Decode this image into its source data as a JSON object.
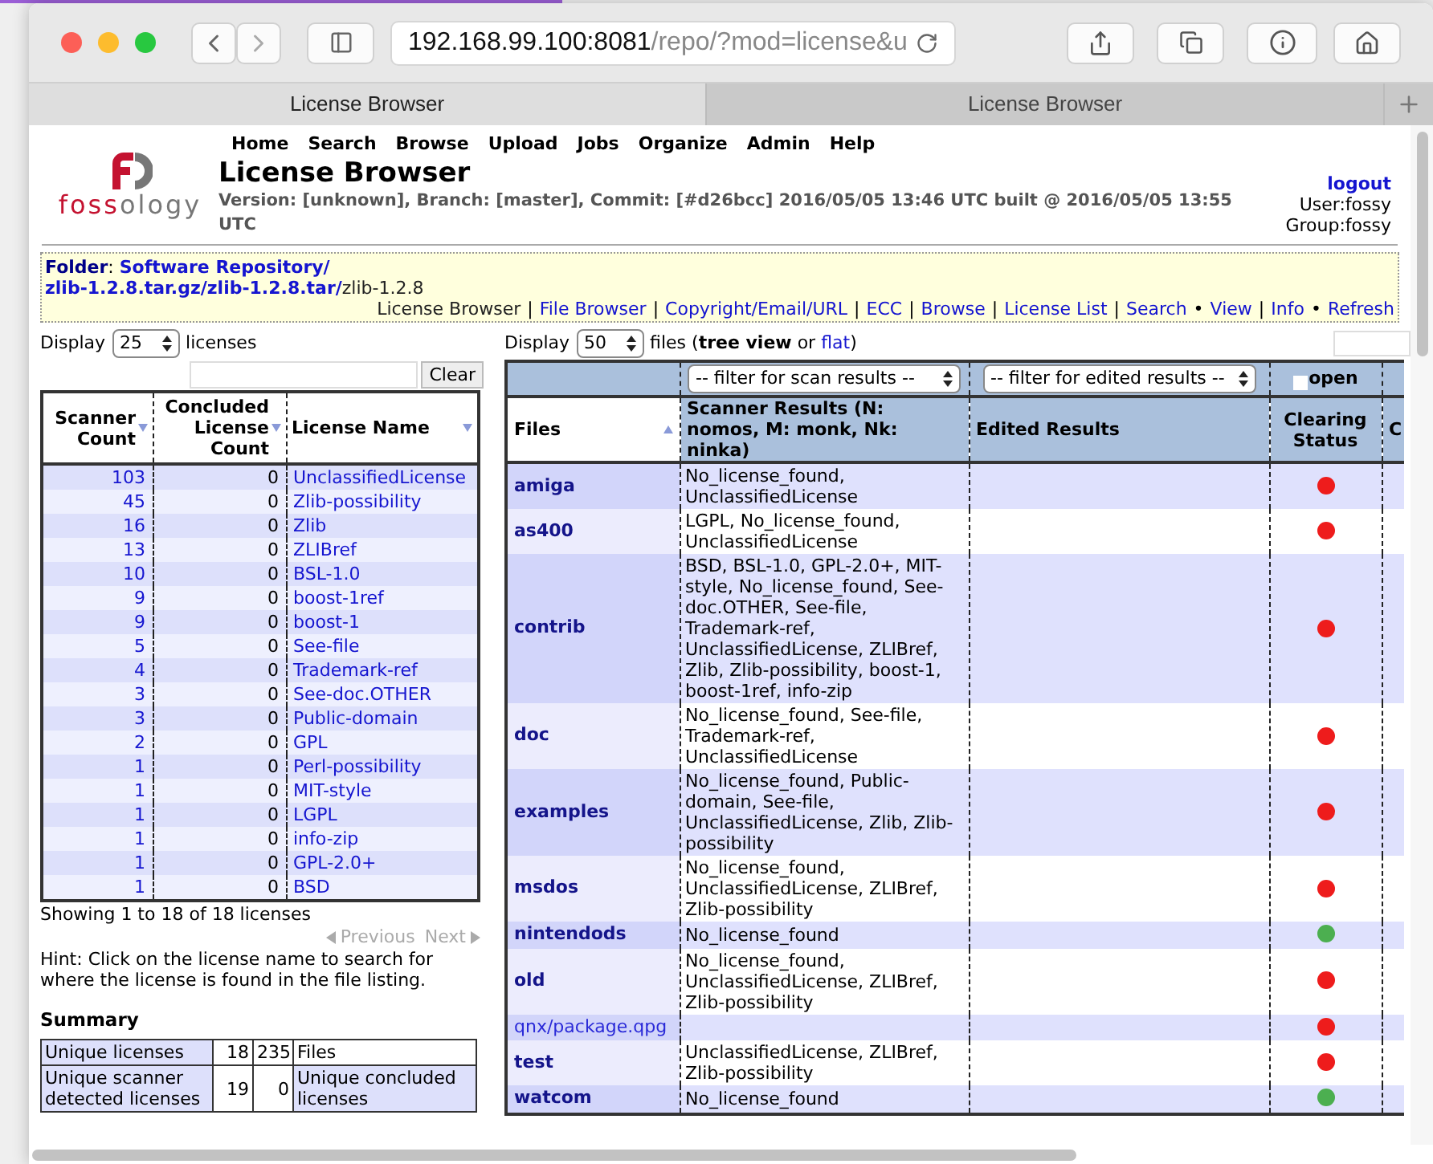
{
  "browser": {
    "address": "192.168.99.100:8081",
    "address_rest": "/repo/?mod=license&u",
    "tabs": [
      {
        "label": "License Browser",
        "selected": true
      },
      {
        "label": "License Browser",
        "selected": false
      }
    ]
  },
  "header": {
    "logo": {
      "lead": "foss",
      "rest": "ology"
    },
    "menu": [
      "Home",
      "Search",
      "Browse",
      "Upload",
      "Jobs",
      "Organize",
      "Admin",
      "Help"
    ],
    "title": "License Browser",
    "version": "Version: [unknown], Branch: [master], Commit: [#d26bcc] 2016/05/05 13:46 UTC built @ 2016/05/05 13:55 UTC",
    "logout": "logout",
    "user": "User:fossy",
    "group": "Group:fossy"
  },
  "folder": {
    "label": "Folder",
    "colon": ":",
    "path": [
      {
        "text": "Software Repository/",
        "link": true,
        "newline": true
      },
      {
        "text": "zlib-1.2.8.tar.gz/",
        "link": true,
        "newline": false
      },
      {
        "text": "zlib-1.2.8.tar/",
        "link": true,
        "newline": false
      },
      {
        "text": "zlib-1.2.8",
        "link": false,
        "newline": false
      }
    ],
    "actions": [
      {
        "text": "License Browser",
        "kind": "current"
      },
      {
        "text": "|",
        "kind": "separator"
      },
      {
        "text": "File Browser",
        "kind": "link"
      },
      {
        "text": "|",
        "kind": "separator"
      },
      {
        "text": "Copyright/Email/URL",
        "kind": "link"
      },
      {
        "text": "|",
        "kind": "separator"
      },
      {
        "text": "ECC",
        "kind": "link"
      },
      {
        "text": "|",
        "kind": "separator"
      },
      {
        "text": "Browse",
        "kind": "link"
      },
      {
        "text": "|",
        "kind": "separator"
      },
      {
        "text": "License List",
        "kind": "link"
      },
      {
        "text": "|",
        "kind": "separator"
      },
      {
        "text": "Search",
        "kind": "link"
      },
      {
        "text": "•",
        "kind": "separator"
      },
      {
        "text": "View",
        "kind": "link"
      },
      {
        "text": "|",
        "kind": "separator"
      },
      {
        "text": "Info",
        "kind": "link"
      },
      {
        "text": "•",
        "kind": "separator"
      },
      {
        "text": "Refresh",
        "kind": "link"
      }
    ]
  },
  "licenses": {
    "display_label": "Display",
    "display_value": "25",
    "display_unit": "licenses",
    "clear": "Clear",
    "columns": [
      "Scanner Count",
      "Concluded License Count",
      "License Name"
    ],
    "rows": [
      {
        "scanner": "103",
        "concluded": "0",
        "name": "UnclassifiedLicense"
      },
      {
        "scanner": "45",
        "concluded": "0",
        "name": "Zlib-possibility"
      },
      {
        "scanner": "16",
        "concluded": "0",
        "name": "Zlib"
      },
      {
        "scanner": "13",
        "concluded": "0",
        "name": "ZLIBref"
      },
      {
        "scanner": "10",
        "concluded": "0",
        "name": "BSL-1.0"
      },
      {
        "scanner": "9",
        "concluded": "0",
        "name": "boost-1ref"
      },
      {
        "scanner": "9",
        "concluded": "0",
        "name": "boost-1"
      },
      {
        "scanner": "5",
        "concluded": "0",
        "name": "See-file"
      },
      {
        "scanner": "4",
        "concluded": "0",
        "name": "Trademark-ref"
      },
      {
        "scanner": "3",
        "concluded": "0",
        "name": "See-doc.OTHER"
      },
      {
        "scanner": "3",
        "concluded": "0",
        "name": "Public-domain"
      },
      {
        "scanner": "2",
        "concluded": "0",
        "name": "GPL"
      },
      {
        "scanner": "1",
        "concluded": "0",
        "name": "Perl-possibility"
      },
      {
        "scanner": "1",
        "concluded": "0",
        "name": "MIT-style"
      },
      {
        "scanner": "1",
        "concluded": "0",
        "name": "LGPL"
      },
      {
        "scanner": "1",
        "concluded": "0",
        "name": "info-zip"
      },
      {
        "scanner": "1",
        "concluded": "0",
        "name": "GPL-2.0+"
      },
      {
        "scanner": "1",
        "concluded": "0",
        "name": "BSD"
      }
    ],
    "showing": "Showing 1 to 18 of 18 licenses",
    "pager": [
      {
        "label": "Previous",
        "disabled": true
      },
      {
        "label": "Next",
        "disabled": true
      }
    ],
    "hint": "Hint: Click on the license name to search for where the license is found in the file listing.",
    "summary_title": "Summary",
    "summary": [
      [
        "Unique licenses",
        "18",
        "235",
        "Files"
      ],
      [
        "Unique scanner detected licenses",
        "19",
        "0",
        "Unique concluded licenses"
      ]
    ]
  },
  "files": {
    "display_label": "Display",
    "display_value": "50",
    "view_before": "files (**tree view** or",
    "view_link": "flat",
    "view_after": ")",
    "scan_filter": "-- filter for scan results --",
    "edited_filter": "-- filter for edited results --",
    "open": {
      "label": "open",
      "checked": false
    },
    "columns": [
      "Files",
      "Scanner Results (N: nomos, M: monk, Nk: ninka)",
      "Edited Results",
      "Clearing Status",
      "C"
    ],
    "rows": [
      {
        "name": "amiga",
        "kind": "folder",
        "scanner": "No_license_found, UnclassifiedLicense",
        "color": "#ee1c1c"
      },
      {
        "name": "as400",
        "kind": "folder",
        "scanner": "LGPL, No_license_found, UnclassifiedLicense",
        "color": "#ee1c1c"
      },
      {
        "name": "contrib",
        "kind": "folder",
        "scanner": "BSD, BSL-1.0, GPL-2.0+, MIT-style, No_license_found, See-doc.OTHER, See-file, Trademark-ref, UnclassifiedLicense, ZLIBref, Zlib, Zlib-possibility, boost-1, boost-1ref, info-zip",
        "color": "#ee1c1c"
      },
      {
        "name": "doc",
        "kind": "folder",
        "scanner": "No_license_found, See-file, Trademark-ref, UnclassifiedLicense",
        "color": "#ee1c1c"
      },
      {
        "name": "examples",
        "kind": "folder",
        "scanner": "No_license_found, Public-domain, See-file, UnclassifiedLicense, Zlib, Zlib-possibility",
        "color": "#ee1c1c"
      },
      {
        "name": "msdos",
        "kind": "folder",
        "scanner": "No_license_found, UnclassifiedLicense, ZLIBref, Zlib-possibility",
        "color": "#ee1c1c"
      },
      {
        "name": "nintendods",
        "kind": "folder",
        "scanner": "No_license_found",
        "color": "#4caf50"
      },
      {
        "name": "old",
        "kind": "folder",
        "scanner": "No_license_found, UnclassifiedLicense, ZLIBref, Zlib-possibility",
        "color": "#ee1c1c"
      },
      {
        "name": "qnx/package.qpg",
        "kind": "file",
        "scanner": "",
        "color": "#ee1c1c"
      },
      {
        "name": "test",
        "kind": "folder",
        "scanner": "UnclassifiedLicense, ZLIBref, Zlib-possibility",
        "color": "#ee1c1c"
      },
      {
        "name": "watcom",
        "kind": "folder",
        "scanner": "No_license_found",
        "color": "#4caf50"
      }
    ]
  }
}
